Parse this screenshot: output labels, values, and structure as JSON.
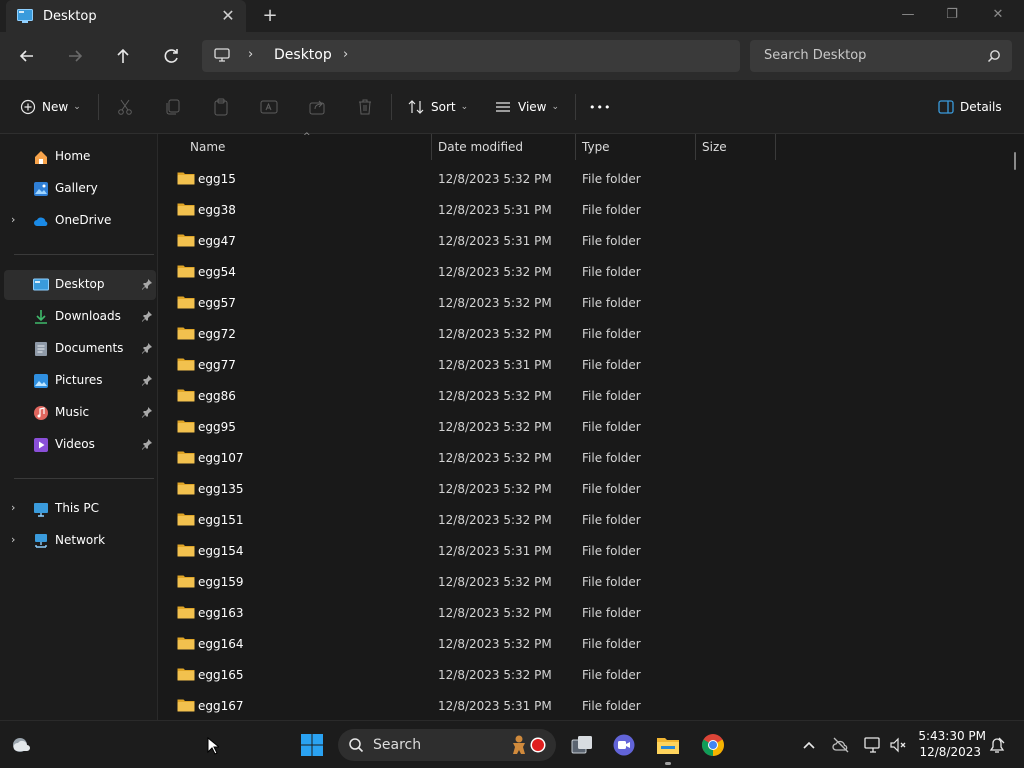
{
  "window": {
    "tab_title": "Desktop",
    "tab_close": "✕",
    "new_tab": "+",
    "minimize": "—",
    "restore": "❐",
    "close": "✕"
  },
  "address": {
    "path": "Desktop",
    "chevron": "›",
    "search_placeholder": "Search Desktop"
  },
  "commands": {
    "new_label": "New",
    "sort_label": "Sort",
    "view_label": "View",
    "more_label": "•••",
    "details_label": "Details",
    "caret": "⌄"
  },
  "sidebar": {
    "expand": "›",
    "items": [
      {
        "label": "Home",
        "icon": "home-icon"
      },
      {
        "label": "Gallery",
        "icon": "gallery-icon"
      },
      {
        "label": "OneDrive",
        "icon": "onedrive-icon"
      },
      {
        "label": "Desktop",
        "icon": "desktop-icon"
      },
      {
        "label": "Downloads",
        "icon": "downloads-icon"
      },
      {
        "label": "Documents",
        "icon": "documents-icon"
      },
      {
        "label": "Pictures",
        "icon": "pictures-icon"
      },
      {
        "label": "Music",
        "icon": "music-icon"
      },
      {
        "label": "Videos",
        "icon": "videos-icon"
      },
      {
        "label": "This PC",
        "icon": "this-pc-icon"
      },
      {
        "label": "Network",
        "icon": "network-icon"
      }
    ]
  },
  "columns": {
    "name": "Name",
    "date": "Date modified",
    "type": "Type",
    "size": "Size",
    "sort_indicator": "^"
  },
  "files": [
    {
      "name": "egg15",
      "date": "12/8/2023 5:32 PM",
      "type": "File folder"
    },
    {
      "name": "egg38",
      "date": "12/8/2023 5:31 PM",
      "type": "File folder"
    },
    {
      "name": "egg47",
      "date": "12/8/2023 5:31 PM",
      "type": "File folder"
    },
    {
      "name": "egg54",
      "date": "12/8/2023 5:32 PM",
      "type": "File folder"
    },
    {
      "name": "egg57",
      "date": "12/8/2023 5:32 PM",
      "type": "File folder"
    },
    {
      "name": "egg72",
      "date": "12/8/2023 5:32 PM",
      "type": "File folder"
    },
    {
      "name": "egg77",
      "date": "12/8/2023 5:31 PM",
      "type": "File folder"
    },
    {
      "name": "egg86",
      "date": "12/8/2023 5:32 PM",
      "type": "File folder"
    },
    {
      "name": "egg95",
      "date": "12/8/2023 5:32 PM",
      "type": "File folder"
    },
    {
      "name": "egg107",
      "date": "12/8/2023 5:32 PM",
      "type": "File folder"
    },
    {
      "name": "egg135",
      "date": "12/8/2023 5:32 PM",
      "type": "File folder"
    },
    {
      "name": "egg151",
      "date": "12/8/2023 5:32 PM",
      "type": "File folder"
    },
    {
      "name": "egg154",
      "date": "12/8/2023 5:31 PM",
      "type": "File folder"
    },
    {
      "name": "egg159",
      "date": "12/8/2023 5:32 PM",
      "type": "File folder"
    },
    {
      "name": "egg163",
      "date": "12/8/2023 5:32 PM",
      "type": "File folder"
    },
    {
      "name": "egg164",
      "date": "12/8/2023 5:32 PM",
      "type": "File folder"
    },
    {
      "name": "egg165",
      "date": "12/8/2023 5:32 PM",
      "type": "File folder"
    },
    {
      "name": "egg167",
      "date": "12/8/2023 5:31 PM",
      "type": "File folder"
    }
  ],
  "taskbar": {
    "search_label": "Search",
    "time": "5:43:30 PM",
    "date": "12/8/2023"
  },
  "colors": {
    "folder": "#f2c14e",
    "accent": "#0078d4"
  }
}
